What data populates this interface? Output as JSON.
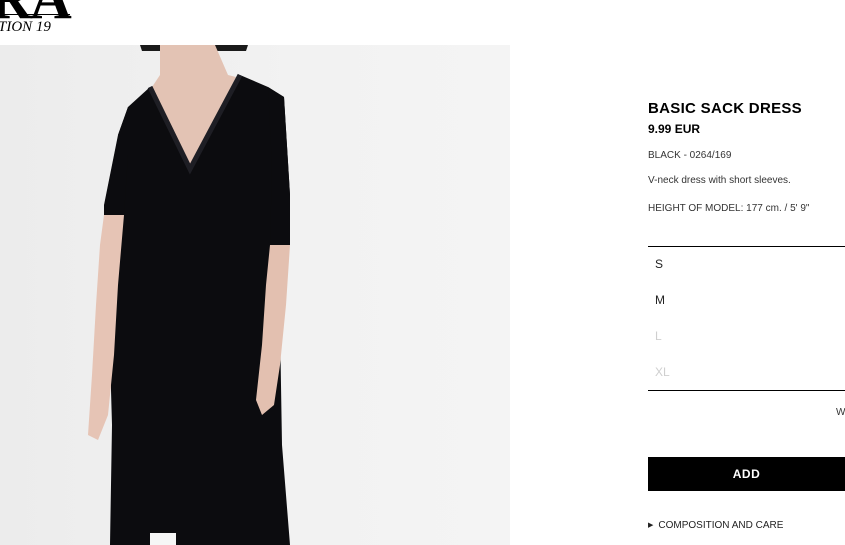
{
  "brand": {
    "logo_text": "RA",
    "collection_text": "TION 19"
  },
  "product": {
    "name": "BASIC SACK DRESS",
    "price": "9.99 EUR",
    "color_ref": "BLACK - 0264/169",
    "description": "V-neck dress with short sleeves.",
    "model_height": "HEIGHT OF MODEL: 177 cm. / 5' 9\""
  },
  "sizes": [
    {
      "label": "S",
      "available": true
    },
    {
      "label": "M",
      "available": true
    },
    {
      "label": "L",
      "available": false
    },
    {
      "label": "XL",
      "available": false
    }
  ],
  "size_guide_label": "W",
  "add_button_label": "ADD",
  "composition_label": "COMPOSITION AND CARE",
  "icons": {
    "composition": "triangle-right-icon"
  },
  "colors": {
    "accent": "#000000",
    "unavailable": "#cfcfcf"
  }
}
